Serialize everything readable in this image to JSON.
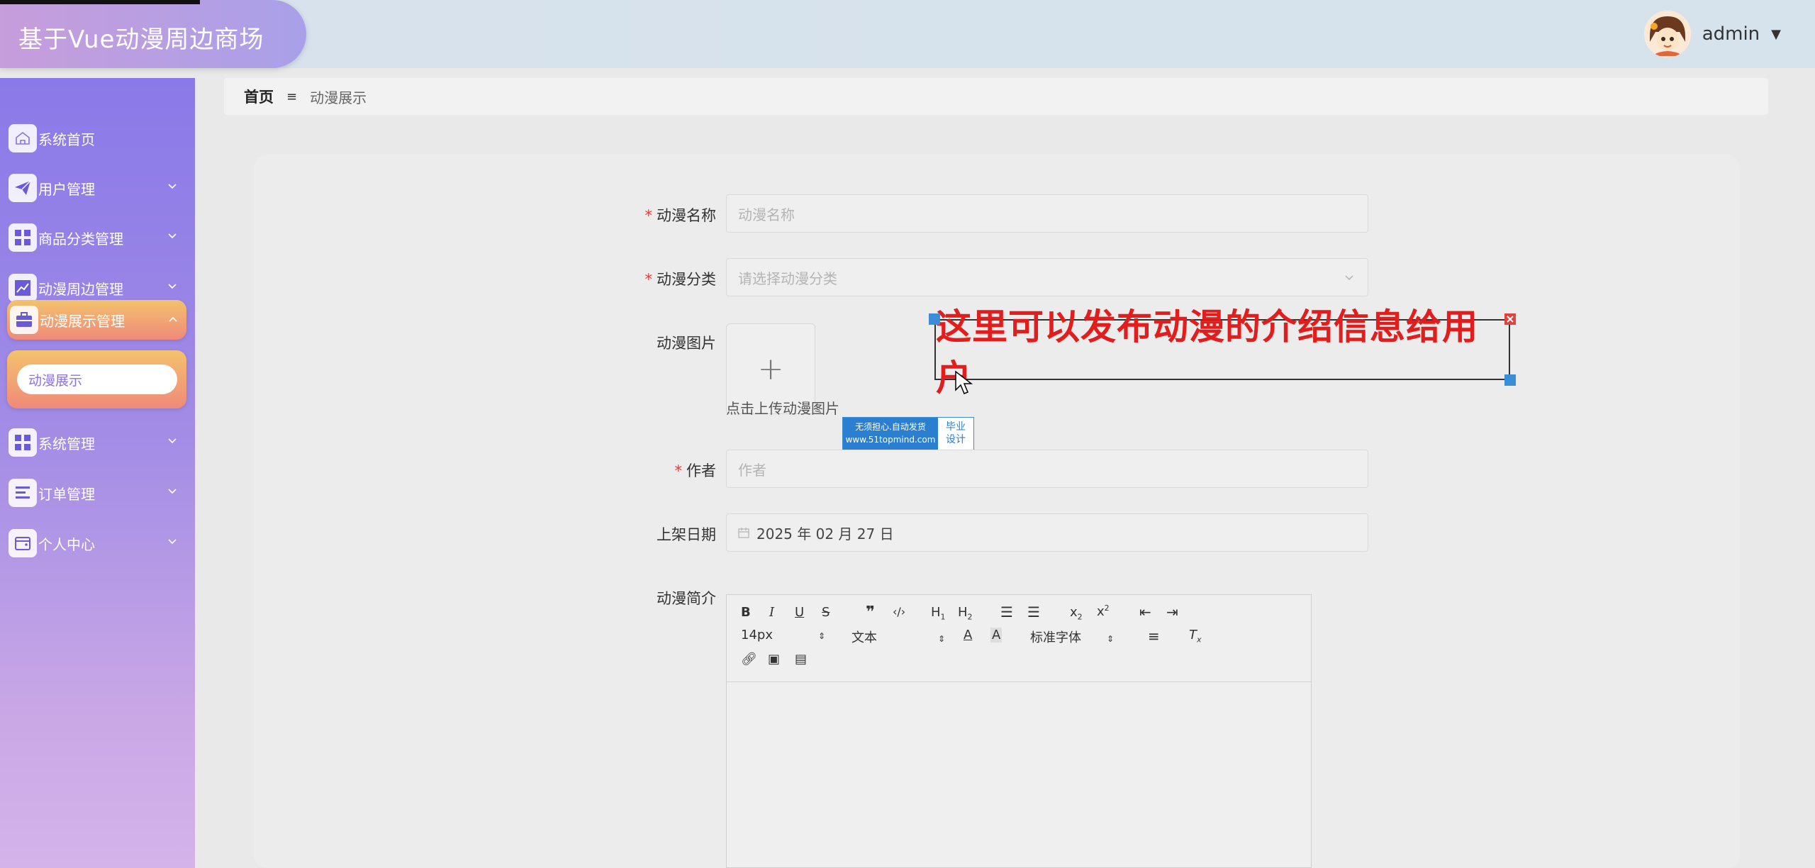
{
  "app": {
    "title": "基于Vue动漫周边商场"
  },
  "user": {
    "name": "admin"
  },
  "sidebar": {
    "items": [
      {
        "label": "系统首页",
        "icon": "home-icon"
      },
      {
        "label": "用户管理",
        "icon": "send-icon"
      },
      {
        "label": "商品分类管理",
        "icon": "grid-icon"
      },
      {
        "label": "动漫周边管理",
        "icon": "chart-icon"
      },
      {
        "label": "动漫展示管理",
        "icon": "briefcase-icon"
      },
      {
        "label": "系统管理",
        "icon": "grid-icon"
      },
      {
        "label": "订单管理",
        "icon": "list-icon"
      },
      {
        "label": "个人中心",
        "icon": "wallet-icon"
      }
    ],
    "submenu": {
      "label": "动漫展示"
    }
  },
  "breadcrumb": {
    "home": "首页",
    "separator": "≡",
    "current": "动漫展示"
  },
  "form": {
    "name": {
      "label": "动漫名称",
      "placeholder": "动漫名称"
    },
    "category": {
      "label": "动漫分类",
      "placeholder": "请选择动漫分类"
    },
    "image": {
      "label": "动漫图片",
      "hint": "点击上传动漫图片"
    },
    "author": {
      "label": "作者",
      "placeholder": "作者"
    },
    "date": {
      "label": "上架日期",
      "value": "2025 年 02 月 27 日"
    },
    "intro": {
      "label": "动漫简介"
    },
    "required_mark": "*"
  },
  "editor": {
    "font_size": "14px",
    "block_type": "文本",
    "font_family": "标准字体"
  },
  "watermark": {
    "line1": "无须担心.自动发货",
    "line2": "www.51topmind.com",
    "right1": "毕业",
    "right2": "设计"
  },
  "annotation": {
    "text": "这里可以发布动漫的介绍信息给用户"
  },
  "colors": {
    "accent": "#8b72e0",
    "active_menu": "#f3c26c",
    "annotation": "#e31c1c",
    "required": "#e23a3a"
  }
}
